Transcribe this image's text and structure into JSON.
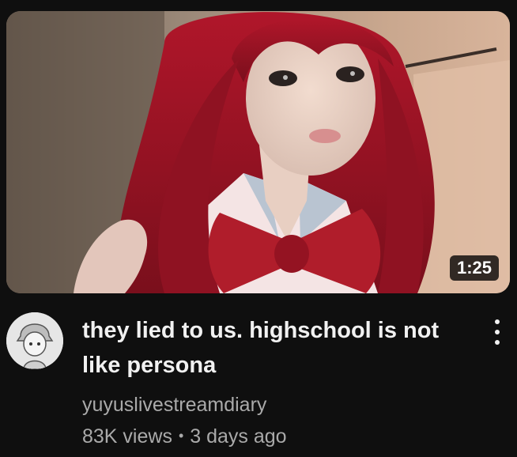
{
  "video": {
    "duration": "1:25",
    "title": "they lied to us. highschool is not like persona",
    "channel": "yuyuslivestreamdiary",
    "views": "83K views",
    "separator": "•",
    "age": "3 days ago"
  },
  "icons": {
    "menu": "more-vert-icon"
  },
  "colors": {
    "background": "#0f0f0f",
    "title": "#f1f1f1",
    "secondary_text": "#aaaaaa",
    "duration_badge": "#000000"
  }
}
